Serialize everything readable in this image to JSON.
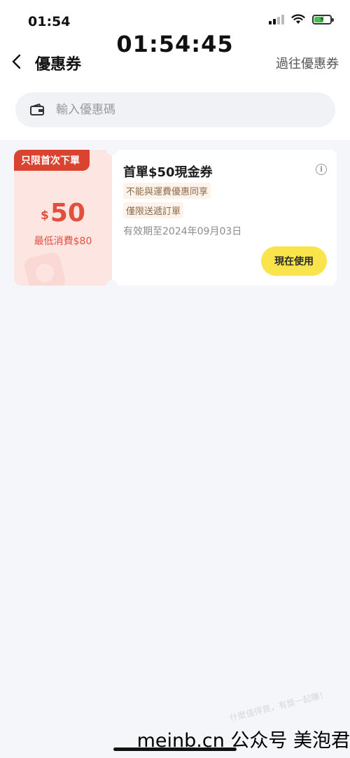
{
  "status_bar": {
    "time": "01:54",
    "signal_icon": "cellular-signal-icon",
    "wifi_icon": "wifi-icon",
    "battery_icon": "battery-charging-icon",
    "battery_level": 0.6
  },
  "clock_overlay": "01:54:45",
  "header": {
    "back_icon": "chevron-left-icon",
    "title": "優惠券",
    "past_link": "過往優惠券"
  },
  "search": {
    "icon": "coupon-wallet-icon",
    "placeholder": "輸入優惠碼"
  },
  "coupons": [
    {
      "ribbon": "只限首次下單",
      "currency": "$",
      "amount": "50",
      "min_spend": "最低消費$80",
      "title": "首單$50現金券",
      "info_icon": "info-icon",
      "tags": [
        "不能與運費優惠同享",
        "僅限送遞訂單"
      ],
      "validity": "有效期至2024年09月03日",
      "action": "現在使用"
    }
  ],
  "watermark": "什麼值得買，有獎一起賺！",
  "footer_brand": "meinb.cn  公众号 美泡君",
  "colors": {
    "accent_red": "#e2503d",
    "ribbon_red": "#d9432f",
    "button_yellow": "#f9e44c",
    "page_bg": "#f5f6fa"
  }
}
